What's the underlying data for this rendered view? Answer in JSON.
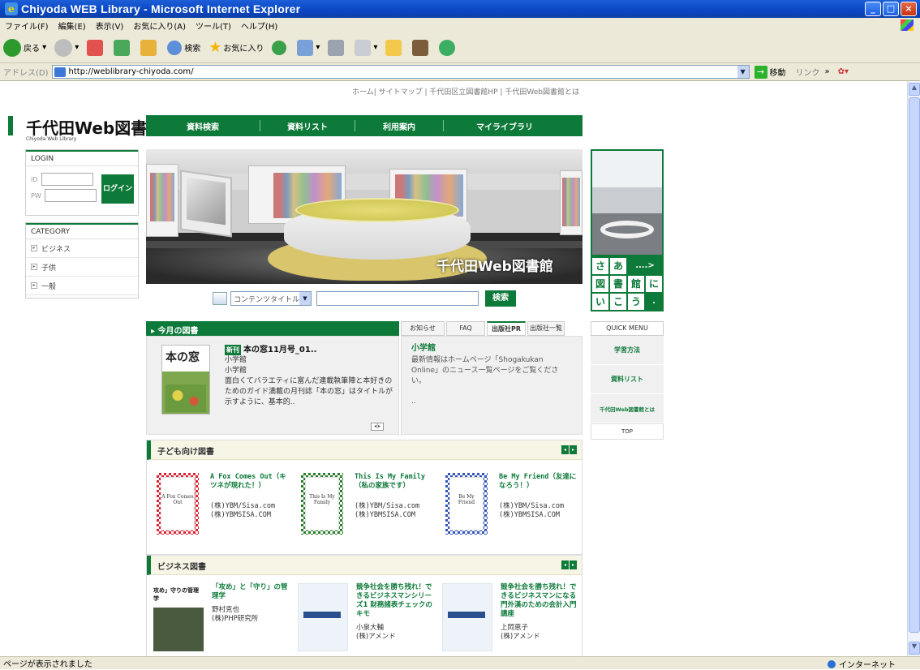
{
  "window": {
    "title": "Chiyoda WEB Library - Microsoft Internet Explorer",
    "menus": [
      "ファイル(F)",
      "編集(E)",
      "表示(V)",
      "お気に入り(A)",
      "ツール(T)",
      "ヘルプ(H)"
    ],
    "toolbar": {
      "back": "戻る",
      "search": "検索",
      "favorites": "お気に入り"
    },
    "address_label": "アドレス(D)",
    "url": "http://weblibrary-chiyoda.com/",
    "go_label": "移動",
    "links_label": "リンク",
    "status_text": "ページが表示されました",
    "zone_text": "インターネット"
  },
  "page": {
    "top_links": "ホーム| サイトマップ | 千代田区立図書館HP | 千代田Web図書館とは",
    "logo_jp": "千代田Web図書館",
    "logo_en": "Chiyoda Web Library",
    "nav": [
      "資料検索",
      "資料リスト",
      "利用案内",
      "マイライブラリ"
    ],
    "login": {
      "title": "LOGIN",
      "id_label": "ID",
      "pw_label": "PW",
      "button": "ログイン"
    },
    "category": {
      "title": "CATEGORY",
      "items": [
        "ビジネス",
        "子供",
        "一般"
      ]
    },
    "hero_title": "千代田Web図書館",
    "side_banner": {
      "cells": [
        "さ",
        "あ",
        "....>",
        "",
        "図",
        "書",
        "館",
        "に",
        "い",
        "こ",
        "う",
        "."
      ]
    },
    "search": {
      "select_value": "コンテンツタイトル",
      "button": "検索"
    },
    "today": {
      "heading": "今月の図書",
      "cover_text": "本の窓",
      "badge": "新刊",
      "title": "本の窓11月号_01..",
      "publisher1": "小学館",
      "publisher2": "小学館",
      "description": "面白くてバラエティに富んだ連載執筆陣と本好きのためのガイド満載の月刊誌「本の窓」はタイトルが示すように、基本的.."
    },
    "tabs": [
      "お知らせ",
      "FAQ",
      "出版社PR",
      "出版社一覧"
    ],
    "news": {
      "title": "小学館",
      "body": "最新情報はホームページ「Shogakukan Online」のニュース一覧ページをご覧ください。",
      "more": ".."
    },
    "quick_menu": {
      "title": "QUICK MENU",
      "items": [
        "学習方法",
        "資料リスト",
        "千代田Web図書館とは"
      ],
      "top": "TOP"
    },
    "kids": {
      "heading": "子ども向け図書",
      "books": [
        {
          "cover": "A Fox Comes Out",
          "title": "A Fox Comes Out（キツネが現れた！）",
          "pub1": "(株)YBM/Sisa.com",
          "pub2": "(株)YBMSISA.COM"
        },
        {
          "cover": "This Is My Family",
          "title": "This Is My Family（私の家族です）",
          "pub1": "(株)YBM/Sisa.com",
          "pub2": "(株)YBMSISA.COM"
        },
        {
          "cover": "Be My Friend",
          "title": "Be My Friend（友達になろう！）",
          "pub1": "(株)YBM/Sisa.com",
          "pub2": "(株)YBMSISA.COM"
        }
      ]
    },
    "business": {
      "heading": "ビジネス図書",
      "books": [
        {
          "cover": "攻め」守りの管理学",
          "title": "「攻め」と「守り」の管理学",
          "author": "野村克也",
          "pub": "(株)PHP研究所"
        },
        {
          "title": "競争社会を勝ち残れ！できるビジネスマンシリーズ1 財務諸表チェックのキモ",
          "author": "小泉大輔",
          "pub": "(株)アメンド"
        },
        {
          "title": "競争社会を勝ち残れ！できるビジネスマンになる 門外漢のための会計入門講座",
          "author": "上岡恵子",
          "pub": "(株)アメンド"
        }
      ]
    }
  },
  "colors": {
    "brand_green": "#0e7a3a",
    "xp_blue": "#0a46c2"
  }
}
